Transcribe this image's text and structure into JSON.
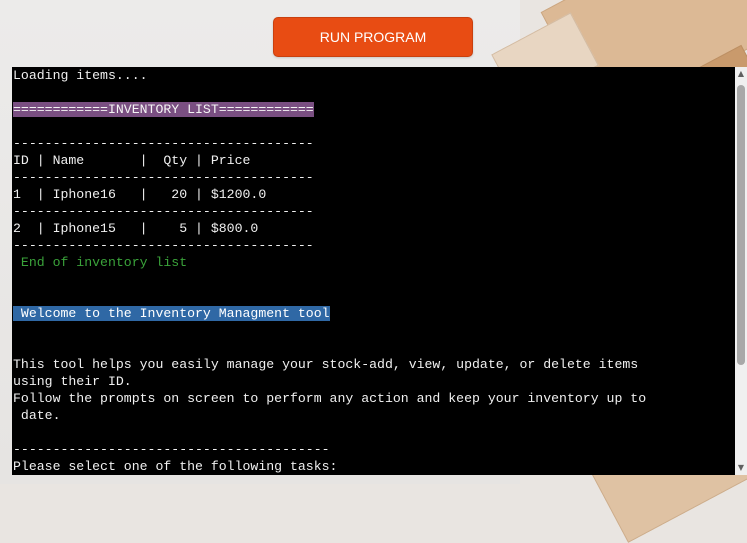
{
  "run_button": {
    "label": "RUN PROGRAM"
  },
  "terminal": {
    "lines": [
      {
        "text": "Loading items....",
        "style": "normal"
      },
      {
        "text": "",
        "style": "normal"
      },
      {
        "text": "============INVENTORY LIST============",
        "style": "purple"
      },
      {
        "text": "",
        "style": "normal"
      },
      {
        "text": "--------------------------------------",
        "style": "normal"
      },
      {
        "text": "ID | Name       |  Qty | Price",
        "style": "normal"
      },
      {
        "text": "--------------------------------------",
        "style": "normal"
      },
      {
        "text": "1  | Iphone16   |   20 | $1200.0",
        "style": "normal"
      },
      {
        "text": "--------------------------------------",
        "style": "normal"
      },
      {
        "text": "2  | Iphone15   |    5 | $800.0",
        "style": "normal"
      },
      {
        "text": "--------------------------------------",
        "style": "normal"
      },
      {
        "text": " End of inventory list",
        "style": "green"
      },
      {
        "text": "",
        "style": "normal"
      },
      {
        "text": "",
        "style": "normal"
      },
      {
        "text": " Welcome to the Inventory Managment tool",
        "style": "blue"
      },
      {
        "text": "",
        "style": "normal"
      },
      {
        "text": "",
        "style": "normal"
      },
      {
        "text": "This tool helps you easily manage your stock-add, view, update, or delete items",
        "style": "normal"
      },
      {
        "text": "using their ID.",
        "style": "normal"
      },
      {
        "text": "Follow the prompts on screen to perform any action and keep your inventory up to",
        "style": "normal"
      },
      {
        "text": " date.",
        "style": "normal"
      },
      {
        "text": "",
        "style": "normal"
      },
      {
        "text": "----------------------------------------",
        "style": "normal"
      },
      {
        "text": "Please select one of the following tasks:",
        "style": "normal"
      }
    ]
  },
  "colors": {
    "run_button": "#e84c13",
    "terminal_bg": "#000000",
    "heading_highlight": "#7a4f82",
    "welcome_highlight": "#2f68a5",
    "end_text": "#3aa23a"
  },
  "icons": {
    "scroll_up": "arrow-up",
    "scroll_down": "arrow-down"
  }
}
